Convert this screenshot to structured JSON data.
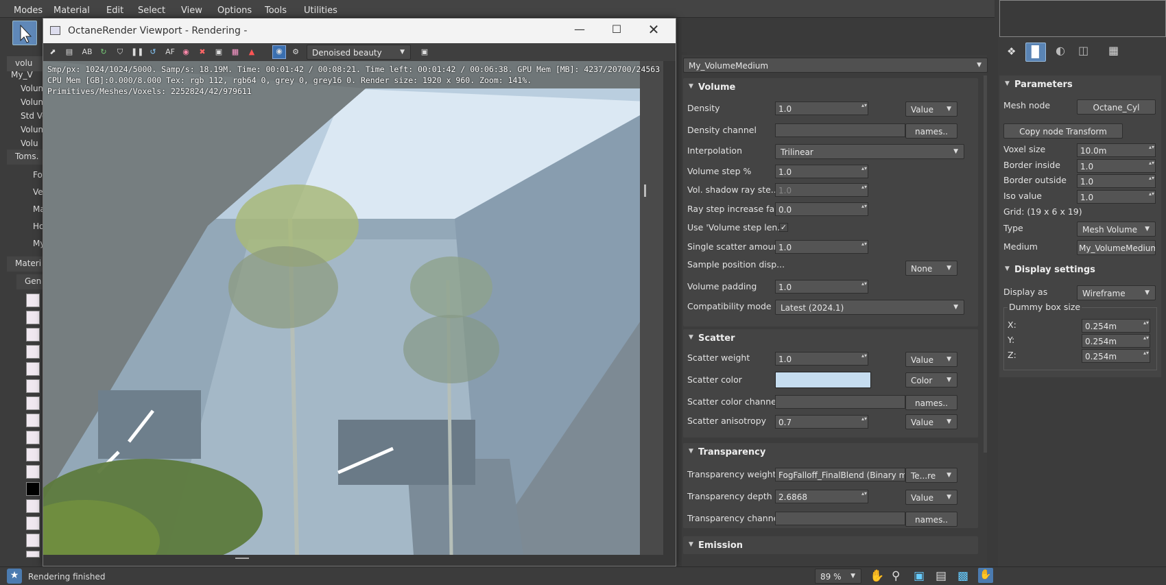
{
  "menu": [
    "Modes",
    "Material",
    "Edit",
    "Select",
    "View",
    "Options",
    "Tools",
    "Utilities"
  ],
  "left": {
    "rows1": [
      "volu",
      "My_V",
      "Volum",
      "Volum",
      "Std Vo",
      "Volum",
      "Volu"
    ],
    "section2": "Toms.",
    "rows2": [
      "Fo",
      "Ve",
      "Ma",
      "Ho",
      "My"
    ],
    "section3": "Materi",
    "subsection3": "Gen"
  },
  "viewport": {
    "title": "OctaneRender Viewport - Rendering -",
    "toolbar_icons": [
      "AB",
      "AF"
    ],
    "render_pass": "Denoised beauty",
    "stats": [
      "Smp/px: 1024/1024/5000.  Samp/s: 18.19M.  Time: 00:01:42 / 00:08:21.  Time left: 00:01:42 / 00:06:38.  GPU Mem [MB]: 4237/20700/24563",
      "CPU Mem [GB]:0.000/8.000  Tex: rgb 112, rgb64 0, grey 0, grey16 0.  Render size: 1920 x 960.  Zoom: 141%.",
      "Primitives/Meshes/Voxels: 2252824/42/979611"
    ]
  },
  "status": {
    "text": "Rendering finished",
    "zoom": "89 %"
  },
  "medium": {
    "name": "My_VolumeMedium",
    "volume": {
      "title": "Volume",
      "density_label": "Density",
      "density": "1.0",
      "density_mode": "Value",
      "density_channel_label": "Density channel",
      "names_btn": "names..",
      "interpolation_label": "Interpolation",
      "interpolation": "Trilinear",
      "volume_step_label": "Volume step %",
      "volume_step": "1.0",
      "vol_shadow_label": "Vol. shadow ray ste...",
      "vol_shadow": "1.0",
      "ray_step_label": "Ray step increase fa...",
      "ray_step": "0.0",
      "use_volume_step_label": "Use 'Volume step len...",
      "single_scatter_label": "Single scatter amount",
      "single_scatter": "1.0",
      "sample_pos_label": "Sample position disp...",
      "sample_pos": "None",
      "volume_padding_label": "Volume padding",
      "volume_padding": "1.0",
      "compat_label": "Compatibility mode",
      "compat": "Latest (2024.1)"
    },
    "scatter": {
      "title": "Scatter",
      "weight_label": "Scatter weight",
      "weight": "1.0",
      "weight_mode": "Value",
      "color_label": "Scatter color",
      "color": "#c6ddf0",
      "color_mode": "Color",
      "color_channel_label": "Scatter color channel",
      "aniso_label": "Scatter anisotropy",
      "aniso": "0.7",
      "aniso_mode": "Value"
    },
    "transparency": {
      "title": "Transparency",
      "weight_label": "Transparency weight",
      "weight": "FogFalloff_FinalBlend (Binary ma",
      "weight_mode": "Te...re",
      "depth_label": "Transparency depth",
      "depth": "2.6868",
      "depth_mode": "Value",
      "channel_label": "Transparency channel"
    },
    "emission": {
      "title": "Emission"
    }
  },
  "params": {
    "title": "Parameters",
    "mesh_node_label": "Mesh node",
    "mesh_node": "Octane_Cyl",
    "copy_btn": "Copy node Transform",
    "voxel_label": "Voxel size",
    "voxel": "10.0m",
    "border_in_label": "Border inside",
    "border_in": "1.0",
    "border_out_label": "Border outside",
    "border_out": "1.0",
    "iso_label": "Iso value",
    "iso": "1.0",
    "grid": "Grid: (19 x 6 x 19)",
    "type_label": "Type",
    "type": "Mesh Volume",
    "medium_label": "Medium",
    "medium": "My_VolumeMedium"
  },
  "display": {
    "title": "Display settings",
    "display_as_label": "Display as",
    "display_as": "Wireframe",
    "dummy_label": "Dummy box size",
    "x_label": "X:",
    "x": "0.254m",
    "y_label": "Y:",
    "y": "0.254m",
    "z_label": "Z:",
    "z": "0.254m"
  }
}
